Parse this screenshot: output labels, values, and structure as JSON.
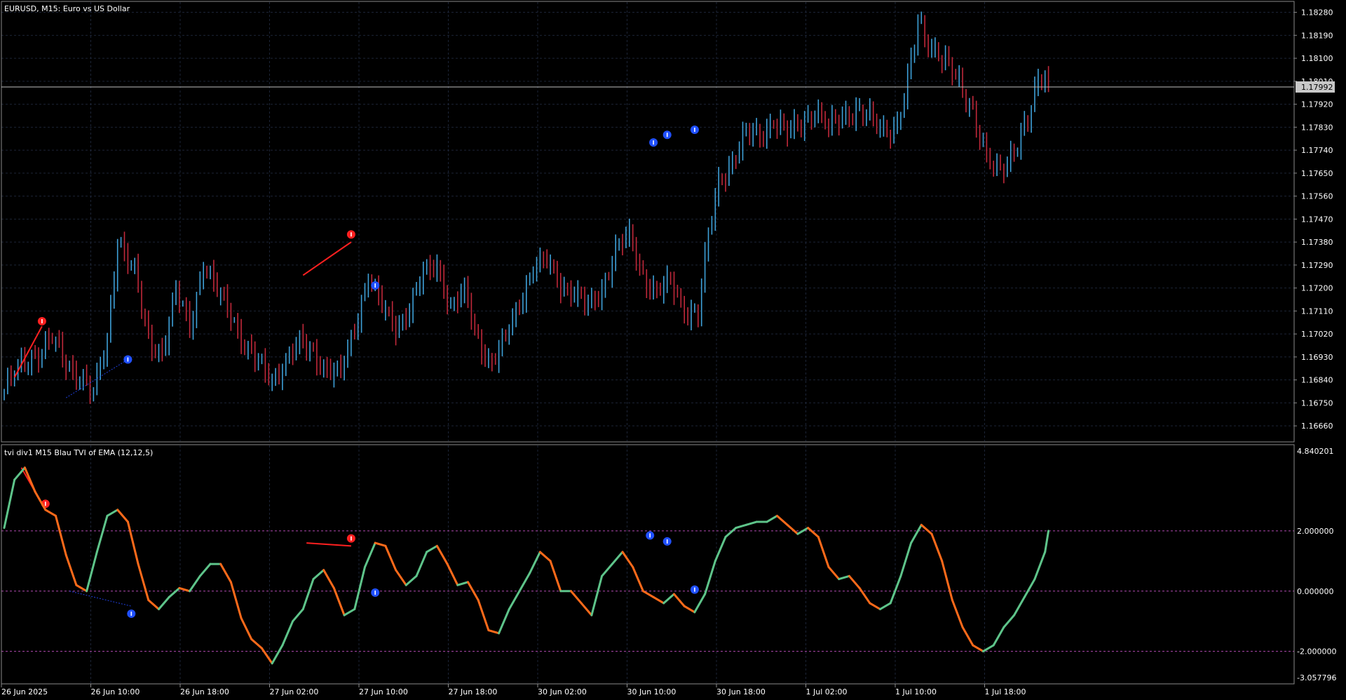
{
  "main_pane": {
    "header": "EURUSD, M15:  Euro vs US Dollar",
    "current_price": "1.17992",
    "price_ticks": [
      "1.18280",
      "1.18190",
      "1.18100",
      "1.18010",
      "1.17920",
      "1.17830",
      "1.17740",
      "1.17650",
      "1.17560",
      "1.17470",
      "1.17380",
      "1.17290",
      "1.17200",
      "1.17110",
      "1.17020",
      "1.16930",
      "1.16840",
      "1.16750",
      "1.16660"
    ]
  },
  "indicator_pane": {
    "header": "tvi div1 M15 Blau TVI of EMA (12,12,5)",
    "scale_max": "4.840201",
    "scale_min": "-3.057796",
    "level_ticks": [
      "2.000000",
      "0.000000",
      "-2.000000"
    ]
  },
  "time_axis": [
    "26 Jun 2025",
    "26 Jun 10:00",
    "26 Jun 18:00",
    "27 Jun 02:00",
    "27 Jun 10:00",
    "27 Jun 18:00",
    "30 Jun 02:00",
    "30 Jun 10:00",
    "30 Jun 18:00",
    "1 Jul 02:00",
    "1 Jul 10:00",
    "1 Jul 18:00"
  ],
  "colors": {
    "background": "#000000",
    "grid": "#1c2436",
    "axis_text": "#ffffff",
    "bull_candle": "#3ea0d8",
    "bear_candle": "#c0283a",
    "tvi_up": "#5ec48a",
    "tvi_down": "#ff6a1a",
    "level_line": "#b04ab0",
    "bear_div_line": "#ff2020",
    "bull_div_line": "#2040e0",
    "bull_arrow": "#2050ff",
    "bear_arrow": "#ff2020",
    "price_line": "#c0c0c0"
  },
  "chart_data": [
    {
      "type": "candlestick",
      "title": "EURUSD, M15:  Euro vs US Dollar",
      "ylim": [
        1.166,
        1.1832
      ],
      "x_labels": [
        "26 Jun 2025",
        "26 Jun 10:00",
        "26 Jun 18:00",
        "27 Jun 02:00",
        "27 Jun 10:00",
        "27 Jun 18:00",
        "30 Jun 02:00",
        "30 Jun 10:00",
        "30 Jun 18:00",
        "1 Jul 02:00",
        "1 Jul 10:00",
        "1 Jul 18:00"
      ],
      "close_path": [
        {
          "bar": 0,
          "close": 1.168
        },
        {
          "bar": 5,
          "close": 1.169
        },
        {
          "bar": 10,
          "close": 1.1695
        },
        {
          "bar": 14,
          "close": 1.17
        },
        {
          "bar": 18,
          "close": 1.169
        },
        {
          "bar": 22,
          "close": 1.1686
        },
        {
          "bar": 26,
          "close": 1.1678
        },
        {
          "bar": 30,
          "close": 1.17
        },
        {
          "bar": 33,
          "close": 1.174
        },
        {
          "bar": 38,
          "close": 1.1725
        },
        {
          "bar": 42,
          "close": 1.17
        },
        {
          "bar": 46,
          "close": 1.1695
        },
        {
          "bar": 50,
          "close": 1.1718
        },
        {
          "bar": 54,
          "close": 1.1705
        },
        {
          "bar": 58,
          "close": 1.173
        },
        {
          "bar": 62,
          "close": 1.1718
        },
        {
          "bar": 66,
          "close": 1.171
        },
        {
          "bar": 70,
          "close": 1.1698
        },
        {
          "bar": 74,
          "close": 1.169
        },
        {
          "bar": 78,
          "close": 1.1684
        },
        {
          "bar": 82,
          "close": 1.1692
        },
        {
          "bar": 86,
          "close": 1.1698
        },
        {
          "bar": 90,
          "close": 1.1695
        },
        {
          "bar": 94,
          "close": 1.1688
        },
        {
          "bar": 98,
          "close": 1.1686
        },
        {
          "bar": 102,
          "close": 1.1705
        },
        {
          "bar": 106,
          "close": 1.1725
        },
        {
          "bar": 110,
          "close": 1.1712
        },
        {
          "bar": 114,
          "close": 1.1705
        },
        {
          "bar": 118,
          "close": 1.1712
        },
        {
          "bar": 122,
          "close": 1.1725
        },
        {
          "bar": 126,
          "close": 1.173
        },
        {
          "bar": 130,
          "close": 1.1712
        },
        {
          "bar": 134,
          "close": 1.1718
        },
        {
          "bar": 138,
          "close": 1.17
        },
        {
          "bar": 142,
          "close": 1.169
        },
        {
          "bar": 146,
          "close": 1.17
        },
        {
          "bar": 150,
          "close": 1.1715
        },
        {
          "bar": 154,
          "close": 1.1728
        },
        {
          "bar": 158,
          "close": 1.173
        },
        {
          "bar": 162,
          "close": 1.1722
        },
        {
          "bar": 166,
          "close": 1.1718
        },
        {
          "bar": 170,
          "close": 1.1712
        },
        {
          "bar": 174,
          "close": 1.172
        },
        {
          "bar": 178,
          "close": 1.1735
        },
        {
          "bar": 182,
          "close": 1.174
        },
        {
          "bar": 186,
          "close": 1.1725
        },
        {
          "bar": 190,
          "close": 1.1718
        },
        {
          "bar": 194,
          "close": 1.1722
        },
        {
          "bar": 198,
          "close": 1.1712
        },
        {
          "bar": 202,
          "close": 1.171
        },
        {
          "bar": 205,
          "close": 1.174
        },
        {
          "bar": 208,
          "close": 1.1762
        },
        {
          "bar": 212,
          "close": 1.177
        },
        {
          "bar": 216,
          "close": 1.178
        },
        {
          "bar": 220,
          "close": 1.178
        },
        {
          "bar": 224,
          "close": 1.1786
        },
        {
          "bar": 228,
          "close": 1.178
        },
        {
          "bar": 232,
          "close": 1.1785
        },
        {
          "bar": 236,
          "close": 1.179
        },
        {
          "bar": 240,
          "close": 1.1782
        },
        {
          "bar": 244,
          "close": 1.1788
        },
        {
          "bar": 248,
          "close": 1.179
        },
        {
          "bar": 252,
          "close": 1.1786
        },
        {
          "bar": 256,
          "close": 1.1782
        },
        {
          "bar": 260,
          "close": 1.1784
        },
        {
          "bar": 263,
          "close": 1.18
        },
        {
          "bar": 266,
          "close": 1.1824
        },
        {
          "bar": 270,
          "close": 1.1815
        },
        {
          "bar": 274,
          "close": 1.1808
        },
        {
          "bar": 278,
          "close": 1.18
        },
        {
          "bar": 282,
          "close": 1.179
        },
        {
          "bar": 286,
          "close": 1.177
        },
        {
          "bar": 289,
          "close": 1.1765
        },
        {
          "bar": 292,
          "close": 1.177
        },
        {
          "bar": 295,
          "close": 1.1778
        },
        {
          "bar": 298,
          "close": 1.1785
        },
        {
          "bar": 301,
          "close": 1.18
        },
        {
          "bar": 303,
          "close": 1.1804
        },
        {
          "bar": 304,
          "close": 1.1799
        }
      ],
      "current_price": 1.17992
    },
    {
      "type": "line",
      "title": "tvi div1 M15 Blau TVI of EMA (12,12,5)",
      "ylim": [
        -3.057796,
        4.840201
      ],
      "levels": [
        2.0,
        0.0,
        -2.0
      ],
      "series": [
        {
          "name": "TVI of EMA (12,12,5)",
          "points": [
            {
              "bar": 0,
              "value": 2.1
            },
            {
              "bar": 3,
              "value": 3.7
            },
            {
              "bar": 6,
              "value": 4.1
            },
            {
              "bar": 9,
              "value": 3.3
            },
            {
              "bar": 12,
              "value": 2.7
            },
            {
              "bar": 15,
              "value": 2.5
            },
            {
              "bar": 18,
              "value": 1.2
            },
            {
              "bar": 21,
              "value": 0.2
            },
            {
              "bar": 24,
              "value": 0.0
            },
            {
              "bar": 27,
              "value": 1.3
            },
            {
              "bar": 30,
              "value": 2.5
            },
            {
              "bar": 33,
              "value": 2.7
            },
            {
              "bar": 36,
              "value": 2.3
            },
            {
              "bar": 39,
              "value": 0.9
            },
            {
              "bar": 42,
              "value": -0.3
            },
            {
              "bar": 45,
              "value": -0.6
            },
            {
              "bar": 48,
              "value": -0.2
            },
            {
              "bar": 51,
              "value": 0.1
            },
            {
              "bar": 54,
              "value": 0.0
            },
            {
              "bar": 57,
              "value": 0.5
            },
            {
              "bar": 60,
              "value": 0.9
            },
            {
              "bar": 63,
              "value": 0.9
            },
            {
              "bar": 66,
              "value": 0.3
            },
            {
              "bar": 69,
              "value": -0.9
            },
            {
              "bar": 72,
              "value": -1.6
            },
            {
              "bar": 75,
              "value": -1.9
            },
            {
              "bar": 78,
              "value": -2.4
            },
            {
              "bar": 81,
              "value": -1.8
            },
            {
              "bar": 84,
              "value": -1.0
            },
            {
              "bar": 87,
              "value": -0.6
            },
            {
              "bar": 90,
              "value": 0.4
            },
            {
              "bar": 93,
              "value": 0.7
            },
            {
              "bar": 96,
              "value": 0.1
            },
            {
              "bar": 99,
              "value": -0.8
            },
            {
              "bar": 102,
              "value": -0.6
            },
            {
              "bar": 105,
              "value": 0.8
            },
            {
              "bar": 108,
              "value": 1.6
            },
            {
              "bar": 111,
              "value": 1.5
            },
            {
              "bar": 114,
              "value": 0.7
            },
            {
              "bar": 117,
              "value": 0.2
            },
            {
              "bar": 120,
              "value": 0.5
            },
            {
              "bar": 123,
              "value": 1.3
            },
            {
              "bar": 126,
              "value": 1.5
            },
            {
              "bar": 129,
              "value": 0.9
            },
            {
              "bar": 132,
              "value": 0.2
            },
            {
              "bar": 135,
              "value": 0.3
            },
            {
              "bar": 138,
              "value": -0.3
            },
            {
              "bar": 141,
              "value": -1.3
            },
            {
              "bar": 144,
              "value": -1.4
            },
            {
              "bar": 147,
              "value": -0.6
            },
            {
              "bar": 150,
              "value": 0.0
            },
            {
              "bar": 153,
              "value": 0.6
            },
            {
              "bar": 156,
              "value": 1.3
            },
            {
              "bar": 159,
              "value": 1.0
            },
            {
              "bar": 162,
              "value": 0.0
            },
            {
              "bar": 165,
              "value": 0.0
            },
            {
              "bar": 168,
              "value": -0.4
            },
            {
              "bar": 171,
              "value": -0.8
            },
            {
              "bar": 174,
              "value": 0.5
            },
            {
              "bar": 177,
              "value": 0.9
            },
            {
              "bar": 180,
              "value": 1.3
            },
            {
              "bar": 183,
              "value": 0.8
            },
            {
              "bar": 186,
              "value": 0.0
            },
            {
              "bar": 189,
              "value": -0.2
            },
            {
              "bar": 192,
              "value": -0.4
            },
            {
              "bar": 195,
              "value": -0.1
            },
            {
              "bar": 198,
              "value": -0.5
            },
            {
              "bar": 201,
              "value": -0.7
            },
            {
              "bar": 204,
              "value": -0.1
            },
            {
              "bar": 207,
              "value": 1.0
            },
            {
              "bar": 210,
              "value": 1.8
            },
            {
              "bar": 213,
              "value": 2.1
            },
            {
              "bar": 216,
              "value": 2.2
            },
            {
              "bar": 219,
              "value": 2.3
            },
            {
              "bar": 222,
              "value": 2.3
            },
            {
              "bar": 225,
              "value": 2.5
            },
            {
              "bar": 228,
              "value": 2.2
            },
            {
              "bar": 231,
              "value": 1.9
            },
            {
              "bar": 234,
              "value": 2.1
            },
            {
              "bar": 237,
              "value": 1.8
            },
            {
              "bar": 240,
              "value": 0.8
            },
            {
              "bar": 243,
              "value": 0.4
            },
            {
              "bar": 246,
              "value": 0.5
            },
            {
              "bar": 249,
              "value": 0.1
            },
            {
              "bar": 252,
              "value": -0.4
            },
            {
              "bar": 255,
              "value": -0.6
            },
            {
              "bar": 258,
              "value": -0.4
            },
            {
              "bar": 261,
              "value": 0.5
            },
            {
              "bar": 264,
              "value": 1.6
            },
            {
              "bar": 267,
              "value": 2.2
            },
            {
              "bar": 270,
              "value": 1.9
            },
            {
              "bar": 273,
              "value": 1.0
            },
            {
              "bar": 276,
              "value": -0.3
            },
            {
              "bar": 279,
              "value": -1.2
            },
            {
              "bar": 282,
              "value": -1.8
            },
            {
              "bar": 285,
              "value": -2.0
            },
            {
              "bar": 288,
              "value": -1.8
            },
            {
              "bar": 291,
              "value": -1.2
            },
            {
              "bar": 294,
              "value": -0.8
            },
            {
              "bar": 297,
              "value": -0.2
            },
            {
              "bar": 300,
              "value": 0.4
            },
            {
              "bar": 303,
              "value": 1.3
            },
            {
              "bar": 304,
              "value": 2.0
            }
          ]
        }
      ]
    }
  ]
}
